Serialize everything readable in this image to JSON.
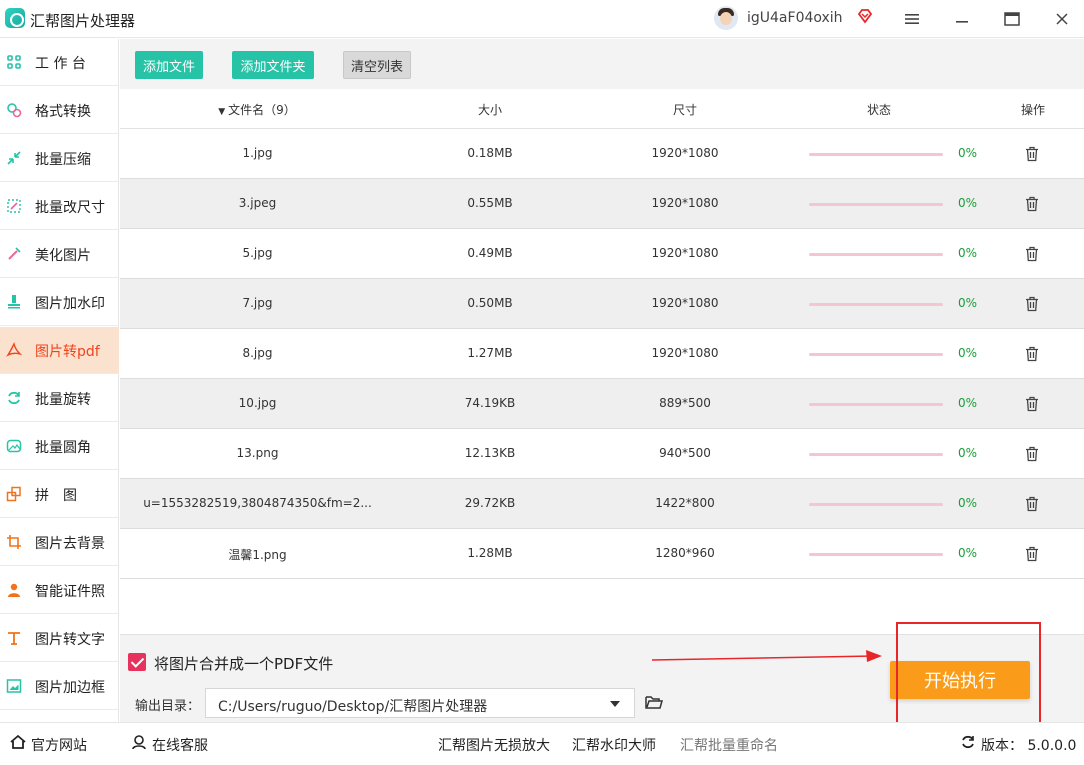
{
  "window": {
    "title": "汇帮图片处理器",
    "username": "igU4aF04oxih",
    "menu_icon": "hamburger-icon",
    "minimize_icon": "minimize-icon",
    "maximize_icon": "maximize-icon",
    "close_icon": "close-icon"
  },
  "sidebar": {
    "items": [
      {
        "label": "工 作 台",
        "icon": "grid-icon",
        "active": false
      },
      {
        "label": "格式转换",
        "icon": "convert-icon",
        "active": false
      },
      {
        "label": "批量压缩",
        "icon": "compress-icon",
        "active": false
      },
      {
        "label": "批量改尺寸",
        "icon": "resize-icon",
        "active": false
      },
      {
        "label": "美化图片",
        "icon": "beautify-icon",
        "active": false
      },
      {
        "label": "图片加水印",
        "icon": "watermark-icon",
        "active": false
      },
      {
        "label": "图片转pdf",
        "icon": "pdf-icon",
        "active": true
      },
      {
        "label": "批量旋转",
        "icon": "rotate-icon",
        "active": false
      },
      {
        "label": "批量圆角",
        "icon": "round-corner-icon",
        "active": false
      },
      {
        "label": "拼　图",
        "icon": "puzzle-icon",
        "active": false
      },
      {
        "label": "图片去背景",
        "icon": "crop-icon",
        "active": false
      },
      {
        "label": "智能证件照",
        "icon": "person-icon",
        "active": false
      },
      {
        "label": "图片转文字",
        "icon": "text-icon",
        "active": false
      },
      {
        "label": "图片加边框",
        "icon": "frame-icon",
        "active": false
      }
    ]
  },
  "toolbar": {
    "add_file": "添加文件",
    "add_folder": "添加文件夹",
    "clear_list": "清空列表"
  },
  "table": {
    "headers": {
      "name": "文件名（9）",
      "size": "大小",
      "dimensions": "尺寸",
      "status": "状态",
      "action": "操作"
    },
    "rows": [
      {
        "name": "1.jpg",
        "size": "0.18MB",
        "dimensions": "1920*1080",
        "progress": 0,
        "status": "0%"
      },
      {
        "name": "3.jpeg",
        "size": "0.55MB",
        "dimensions": "1920*1080",
        "progress": 0,
        "status": "0%"
      },
      {
        "name": "5.jpg",
        "size": "0.49MB",
        "dimensions": "1920*1080",
        "progress": 0,
        "status": "0%"
      },
      {
        "name": "7.jpg",
        "size": "0.50MB",
        "dimensions": "1920*1080",
        "progress": 0,
        "status": "0%"
      },
      {
        "name": "8.jpg",
        "size": "1.27MB",
        "dimensions": "1920*1080",
        "progress": 0,
        "status": "0%"
      },
      {
        "name": "10.jpg",
        "size": "74.19KB",
        "dimensions": "889*500",
        "progress": 0,
        "status": "0%"
      },
      {
        "name": "13.png",
        "size": "12.13KB",
        "dimensions": "940*500",
        "progress": 0,
        "status": "0%"
      },
      {
        "name": "u=1553282519,3804874350&fm=2...",
        "size": "29.72KB",
        "dimensions": "1422*800",
        "progress": 0,
        "status": "0%"
      },
      {
        "name": "温馨1.png",
        "size": "1.28MB",
        "dimensions": "1280*960",
        "progress": 0,
        "status": "0%"
      }
    ]
  },
  "options": {
    "merge_checked": true,
    "merge_label": "将图片合并成一个PDF文件",
    "output_label": "输出目录：",
    "output_path": "C:/Users/ruguo/Desktop/汇帮图片处理器",
    "start_button": "开始执行"
  },
  "footer": {
    "website": "官方网站",
    "support": "在线客服",
    "link1": "汇帮图片无损放大",
    "link2": "汇帮水印大师",
    "link3": "汇帮批量重命名",
    "version": "版本： 5.0.0.0"
  },
  "colors": {
    "accent_teal": "#27c3a7",
    "active_bg": "#fbe2cf",
    "active_text": "#f0431c",
    "start_orange": "#fa9c19",
    "status_green": "#1a9c3a",
    "annotation_red": "#e8262a"
  }
}
